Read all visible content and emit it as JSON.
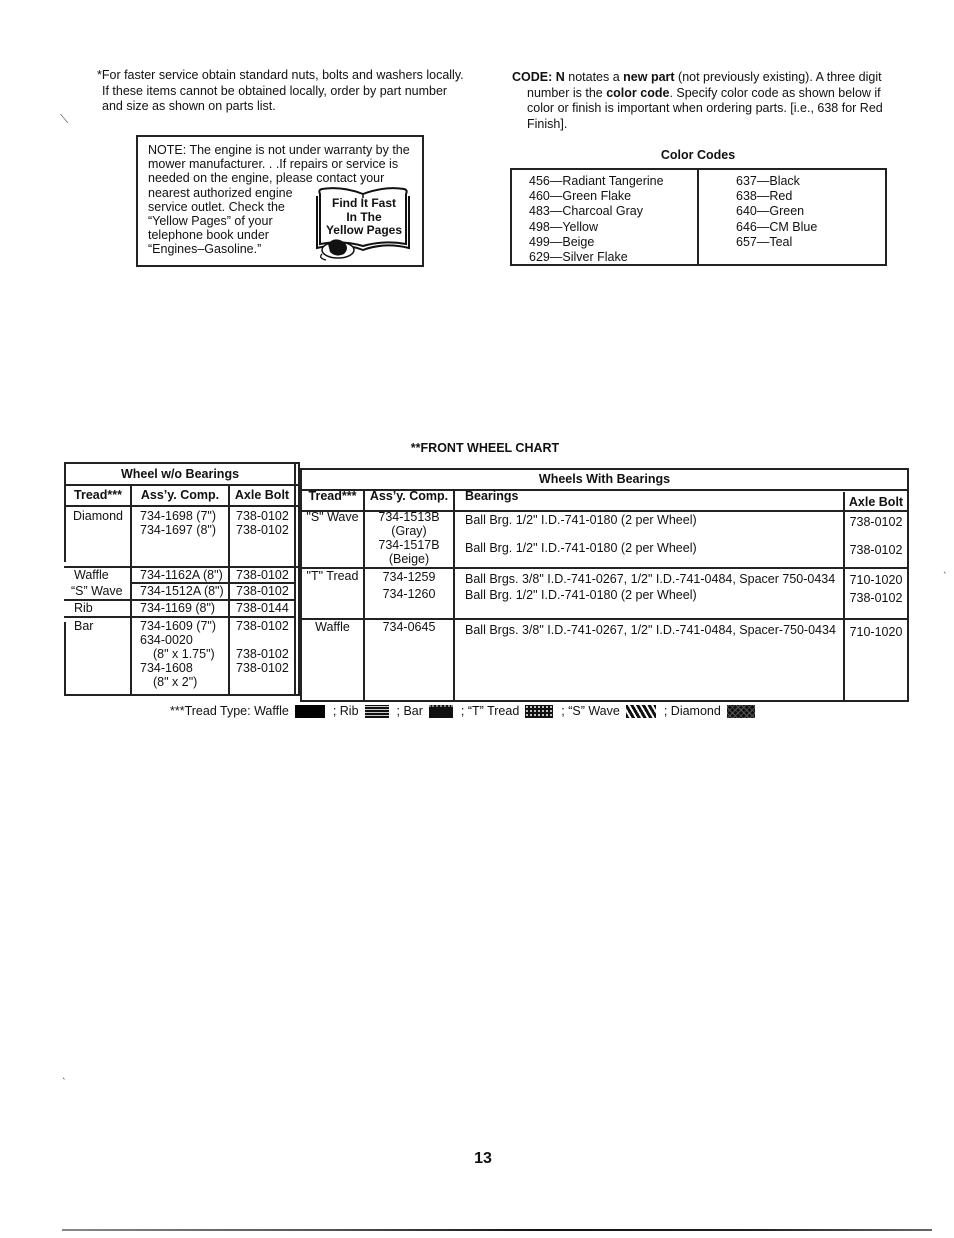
{
  "intro_note": {
    "lines": [
      "*For faster service obtain standard nuts, bolts and washers locally.",
      "If these items cannot be obtained locally, order by part number",
      "and size as shown on parts list."
    ]
  },
  "engine_note": {
    "line1": "NOTE: The engine is not under warranty by the",
    "line2": "mower manufacturer. . .If repairs or service is",
    "line3": "needed on the engine, please contact your",
    "narrow_lines": [
      "nearest authorized engine",
      "service outlet. Check the",
      "“Yellow Pages” of your",
      "telephone book under",
      "“Engines–Gasoline.”"
    ],
    "graphic": {
      "icon": "yellow-pages-book-phone-icon",
      "lines": [
        "Find It Fast",
        "In The",
        "Yellow Pages"
      ]
    }
  },
  "code_note": {
    "prefix_bold": "CODE: N",
    "text1": " notates a ",
    "bold2": "new part",
    "text2": " (not previously existing). A three digit",
    "text3": "number is the ",
    "bold3": "color code",
    "text4": ". Specify color code as shown below if",
    "text5": "color or finish is important when ordering parts. [i.e., 638 for Red",
    "text6": "Finish]."
  },
  "color_codes": {
    "title": "Color Codes",
    "left": [
      "456—Radiant Tangerine",
      "460—Green Flake",
      "483—Charcoal Gray",
      "498—Yellow",
      "499—Beige",
      "629—Silver Flake"
    ],
    "right": [
      "637—Black",
      "638—Red",
      "640—Green",
      "646—CM Blue",
      "657—Teal"
    ]
  },
  "front_wheel_chart": {
    "title": "**FRONT WHEEL CHART",
    "without_bearings": {
      "heading": "Wheel w/o Bearings",
      "columns": [
        "Tread***",
        "Ass’y. Comp.",
        "Axle Bolt"
      ],
      "rows": [
        {
          "tread": "Diamond",
          "assy": [
            "734-1698 (7\")",
            "734-1697 (8\")"
          ],
          "bolt": [
            "738-0102",
            "738-0102"
          ]
        },
        {
          "tread": "Waffle",
          "assy": [
            "734-1162A (8\")"
          ],
          "bolt": [
            "738-0102"
          ]
        },
        {
          "tread": "“S” Wave",
          "assy": [
            "734-1512A (8\")"
          ],
          "bolt": [
            "738-0102"
          ]
        },
        {
          "tread": "Rib",
          "assy": [
            "734-1169 (8\")"
          ],
          "bolt": [
            "738-0144"
          ]
        },
        {
          "tread": "Bar",
          "assy": [
            "734-1609 (7\")",
            "634-0020",
            "(8\" x 1.75\")",
            "734-1608",
            "(8\" x 2\")"
          ],
          "bolt": [
            "738-0102",
            "",
            "738-0102",
            "738-0102"
          ]
        }
      ]
    },
    "with_bearings": {
      "heading": "Wheels With Bearings",
      "columns": [
        "Tread***",
        "Ass’y. Comp.",
        "Bearings",
        "Axle Bolt"
      ],
      "rows": [
        {
          "tread": "\"S\" Wave",
          "assy": [
            "734-1513B",
            "(Gray)",
            "734-1517B",
            "(Beige)"
          ],
          "bearings": [
            "Ball Brg. 1/2\" I.D.-741-0180 (2 per Wheel)",
            "Ball Brg. 1/2\" I.D.-741-0180 (2 per Wheel)"
          ],
          "bolt": [
            "738-0102",
            "738-0102"
          ]
        },
        {
          "tread": "\"T\" Tread",
          "assy": [
            "734-1259",
            "734-1260"
          ],
          "bearings": [
            "Ball Brgs. 3/8\" I.D.-741-0267, 1/2\" I.D.-741-0484, Spacer 750-0434",
            "Ball Brg. 1/2\" I.D.-741-0180 (2 per Wheel)"
          ],
          "bolt": [
            "710-1020",
            "738-0102"
          ]
        },
        {
          "tread": "Waffle",
          "assy": [
            "734-0645"
          ],
          "bearings": [
            "Ball Brgs. 3/8\" I.D.-741-0267, 1/2\" I.D.-741-0484, Spacer-750-0434"
          ],
          "bolt": [
            "710-1020"
          ]
        }
      ]
    },
    "legend": {
      "prefix": "***Tread Type: Waffle",
      "items": [
        {
          "label": "; Rib"
        },
        {
          "label": "; Bar"
        },
        {
          "label": "; “T” Tread"
        },
        {
          "label": "; “S” Wave"
        },
        {
          "label": "; Diamond"
        }
      ]
    }
  },
  "page_number": "13"
}
